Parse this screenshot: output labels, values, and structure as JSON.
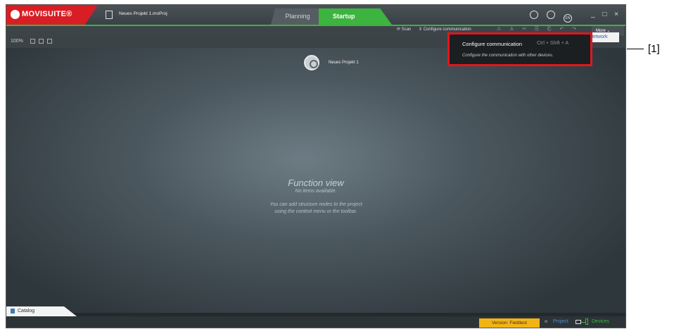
{
  "app": {
    "logo_text": "MOVISUITE®",
    "project_file": "Neues Projekt 1.moProj"
  },
  "tabs": [
    {
      "label": "Planning"
    },
    {
      "label": "Startup"
    }
  ],
  "header_icons": [
    "mail-icon",
    "search-icon",
    "language-icon"
  ],
  "language": "EN",
  "window_controls": "_ □ ×",
  "toolbar": {
    "scan_label": "Scan",
    "configure_label": "Configure communication",
    "more_label": "More"
  },
  "zoom": {
    "level": "100%"
  },
  "network_menu_item": "Network",
  "node": {
    "label": "Neues Projekt 1"
  },
  "function_view": {
    "title": "Function view",
    "subtitle": "No items available.",
    "hint_line1": "You can add structure nodes to the project",
    "hint_line2": "using the context menu or the toolbar."
  },
  "tooltip": {
    "title": "Configure communication",
    "shortcut": "Ctrl + Shift + A",
    "description": "Configure the communication with other devices."
  },
  "catalog_label": "Catalog",
  "status": {
    "version": "Version: Fieldtest",
    "project_label": "Project",
    "devices_label": "Devices"
  },
  "callout": "[1]",
  "colors": {
    "brand_red": "#d81e24",
    "startup_green": "#3db340",
    "version_yellow": "#f2b414",
    "highlight_red": "#e3161c"
  }
}
